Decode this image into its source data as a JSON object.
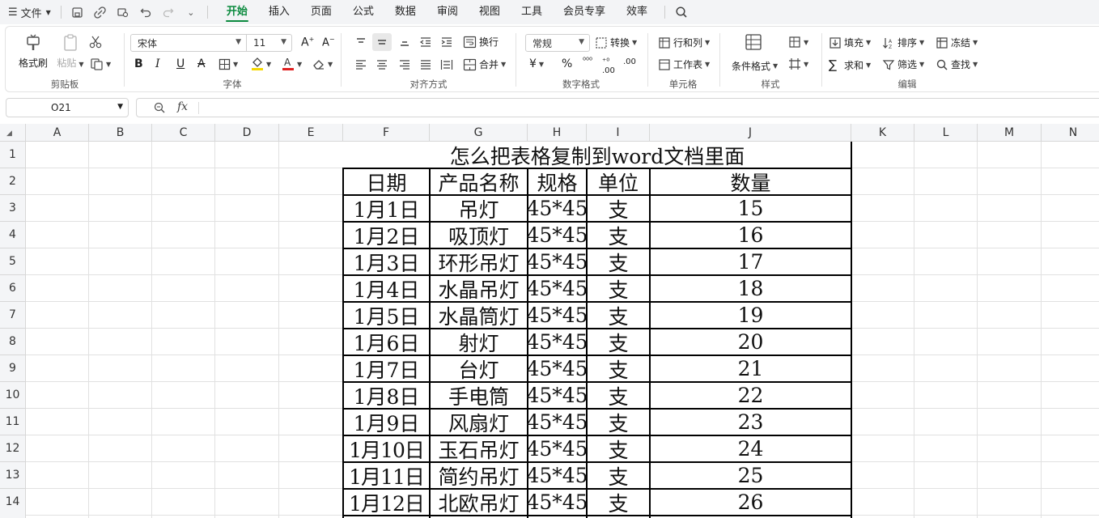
{
  "menu": {
    "file": "文件",
    "tabs": [
      "开始",
      "插入",
      "页面",
      "公式",
      "数据",
      "审阅",
      "视图",
      "工具",
      "会员专享",
      "效率"
    ],
    "active_tab": "开始"
  },
  "ribbon": {
    "clipboard": {
      "format_painter": "格式刷",
      "paste": "粘贴",
      "label": "剪贴板"
    },
    "font": {
      "name": "宋体",
      "size": "11",
      "label": "字体",
      "font_color": "#e02020",
      "fill_color": "#f5d800"
    },
    "align": {
      "wrap": "换行",
      "merge": "合并",
      "label": "对齐方式"
    },
    "number": {
      "format": "常规",
      "convert": "转换",
      "label": "数字格式"
    },
    "cells": {
      "rows_cols": "行和列",
      "worksheet": "工作表",
      "label": "单元格"
    },
    "styles": {
      "cond_format": "条件格式",
      "label": "样式"
    },
    "edit": {
      "fill": "填充",
      "sort": "排序",
      "freeze": "冻结",
      "sum": "求和",
      "filter": "筛选",
      "find": "查找",
      "label": "编辑"
    }
  },
  "formula_bar": {
    "name_box": "O21",
    "fx": "fx",
    "content": ""
  },
  "columns": [
    "A",
    "B",
    "C",
    "D",
    "E",
    "F",
    "G",
    "H",
    "I",
    "J",
    "K",
    "L",
    "M",
    "N"
  ],
  "rows": [
    "1",
    "2",
    "3",
    "4",
    "5",
    "6",
    "7",
    "8",
    "9",
    "10",
    "11",
    "12",
    "13",
    "14"
  ],
  "sheet": {
    "title": "怎么把表格复制到word文档里面",
    "headers": [
      "日期",
      "产品名称",
      "规格",
      "单位",
      "数量"
    ],
    "data": [
      [
        "1月1日",
        "吊灯",
        "45*45",
        "支",
        "15"
      ],
      [
        "1月2日",
        "吸顶灯",
        "45*45",
        "支",
        "16"
      ],
      [
        "1月3日",
        "环形吊灯",
        "45*45",
        "支",
        "17"
      ],
      [
        "1月4日",
        "水晶吊灯",
        "45*45",
        "支",
        "18"
      ],
      [
        "1月5日",
        "水晶筒灯",
        "45*45",
        "支",
        "19"
      ],
      [
        "1月6日",
        "射灯",
        "45*45",
        "支",
        "20"
      ],
      [
        "1月7日",
        "台灯",
        "45*45",
        "支",
        "21"
      ],
      [
        "1月8日",
        "手电筒",
        "45*45",
        "支",
        "22"
      ],
      [
        "1月9日",
        "风扇灯",
        "45*45",
        "支",
        "23"
      ],
      [
        "1月10日",
        "玉石吊灯",
        "45*45",
        "支",
        "24"
      ],
      [
        "1月11日",
        "简约吊灯",
        "45*45",
        "支",
        "25"
      ],
      [
        "1月12日",
        "北欧吊灯",
        "45*45",
        "支",
        "26"
      ]
    ]
  },
  "colors": {
    "accent": "#0b8a3e",
    "menubar_bg": "#f3f4f6",
    "header_bg": "#f4f5f7"
  }
}
